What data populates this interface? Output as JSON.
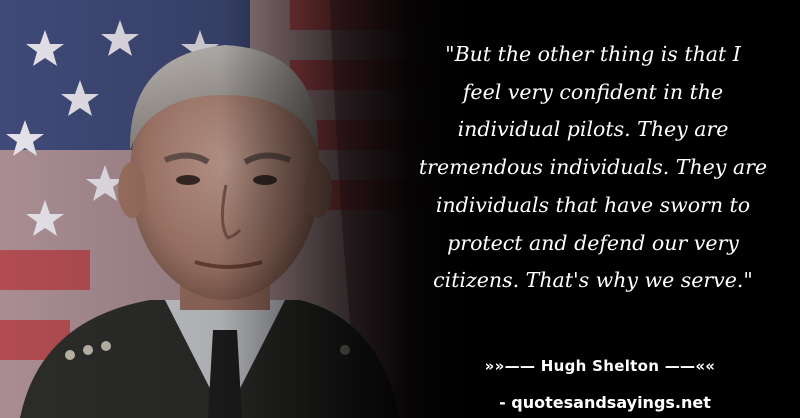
{
  "quote": {
    "text": "\"But the other thing is that I\nfeel very confident in the\nindividual pilots. They are\ntremendous individuals. They are\nindividuals that have sworn to\nprotect and defend our very\ncitizens. That's why we serve.\""
  },
  "attribution": {
    "text": "»»—— Hugh Shelton ——««"
  },
  "site": {
    "text": "- quotesandsayings.net"
  },
  "colors": {
    "background": "#000000",
    "text": "#ffffff"
  }
}
